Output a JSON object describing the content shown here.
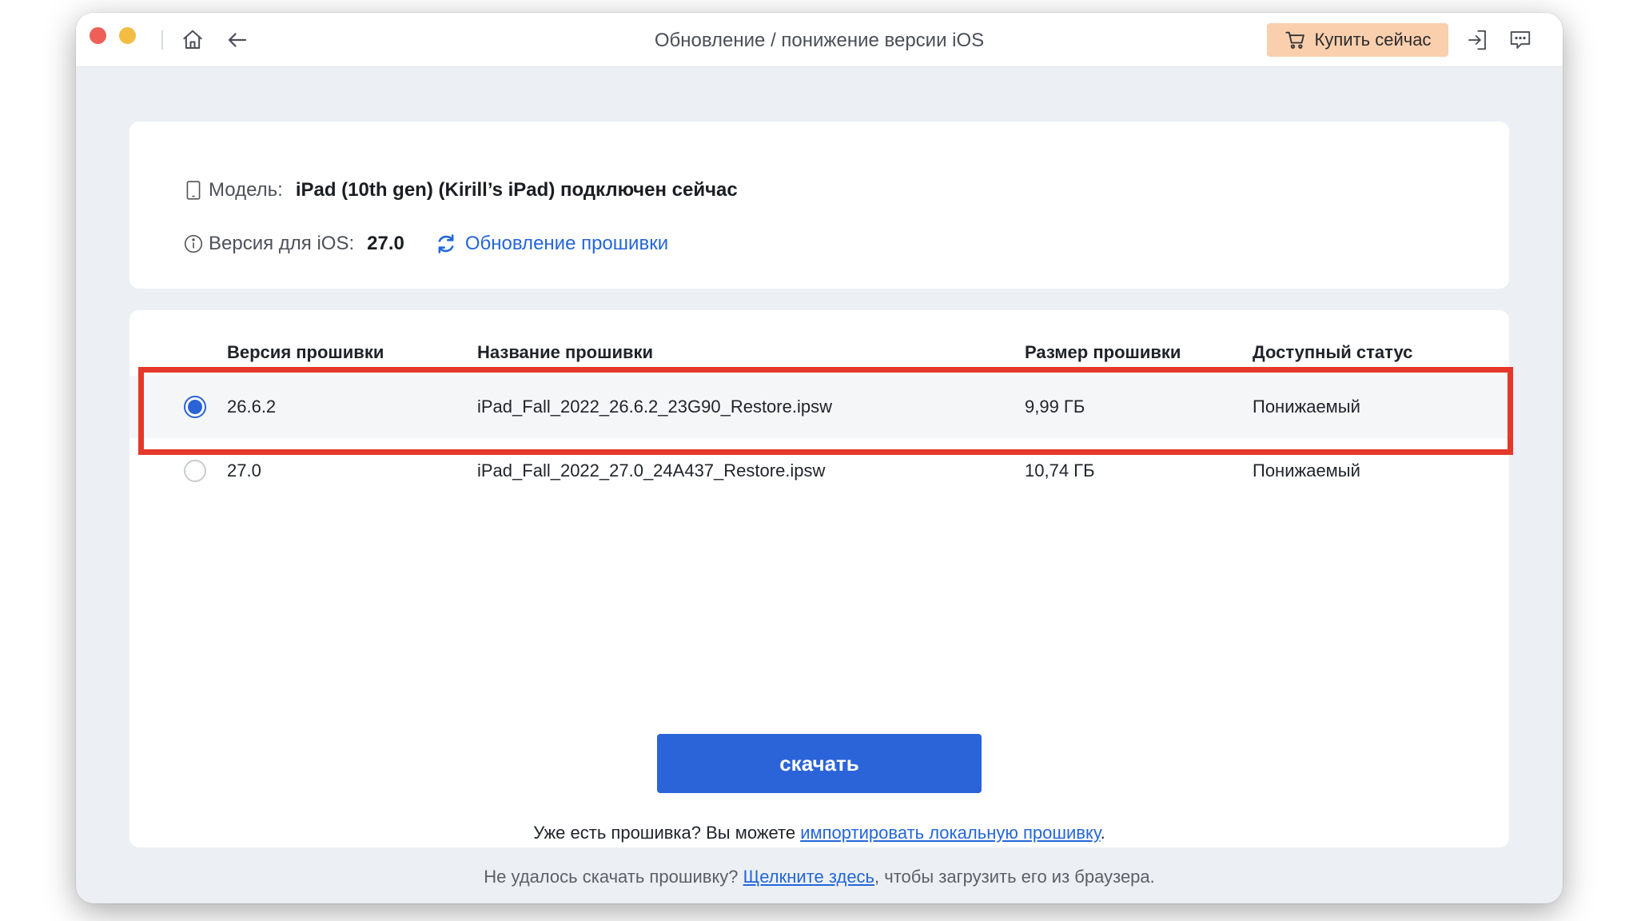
{
  "window": {
    "title": "Обновление / понижение версии iOS",
    "buy_now_label": "Купить сейчас"
  },
  "device": {
    "model_label": "Модель:",
    "model_value": "iPad (10th gen) (Kirill’s iPad) подключен сейчас",
    "ios_label": "Версия для iOS:",
    "ios_value": "27.0",
    "refresh_link": "Обновление прошивки"
  },
  "table": {
    "headers": {
      "version": "Версия прошивки",
      "name": "Название прошивки",
      "size": "Размер прошивки",
      "status": "Доступный статус"
    },
    "rows": [
      {
        "version": "26.6.2",
        "name": "iPad_Fall_2022_26.6.2_23G90_Restore.ipsw",
        "size": "9,99 ГБ",
        "status": "Понижаемый",
        "selected": true
      },
      {
        "version": "27.0",
        "name": "iPad_Fall_2022_27.0_24A437_Restore.ipsw",
        "size": "10,74 ГБ",
        "status": "Понижаемый",
        "selected": false
      }
    ]
  },
  "download_label": "скачать",
  "import": {
    "prefix": "Уже есть прошивка? Вы можете ",
    "link": "импортировать локальную прошивку",
    "suffix": "."
  },
  "footer": {
    "prefix": "Не удалось скачать прошивку? ",
    "link": "Щелкните здесь",
    "suffix": ", чтобы загрузить его из браузера."
  },
  "colors": {
    "accent": "#2b63d9",
    "highlight": "#e4382a",
    "buy_button": "#f9cfae"
  },
  "icons": [
    "home-icon",
    "back-arrow-icon",
    "cart-icon",
    "sign-in-icon",
    "feedback-icon",
    "tablet-icon",
    "info-icon",
    "refresh-icon"
  ]
}
